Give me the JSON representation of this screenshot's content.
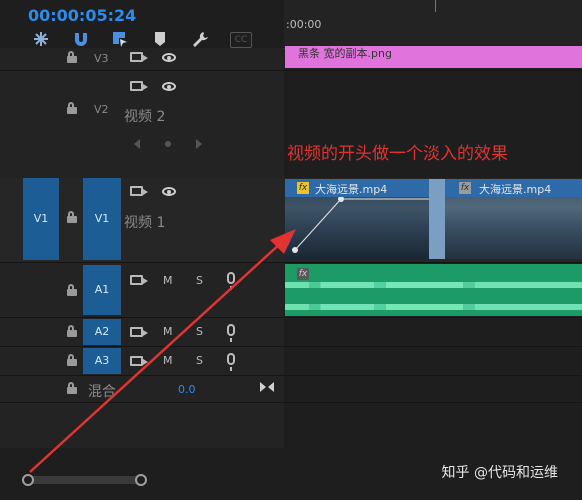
{
  "timecode": "00:00:05:24",
  "ruler": {
    "start_label": ":00:00"
  },
  "toolbar": {
    "tools": [
      {
        "name": "snap-icon"
      },
      {
        "name": "magnet-icon"
      },
      {
        "name": "linked-selection-icon"
      },
      {
        "name": "marker-icon"
      },
      {
        "name": "wrench-icon"
      },
      {
        "name": "captions-icon",
        "label": "CC"
      }
    ]
  },
  "tracks": {
    "v3": {
      "label": "V3"
    },
    "v2": {
      "label": "V2",
      "name": "视频 2"
    },
    "v1": {
      "source": "V1",
      "label": "V1",
      "name": "视频 1"
    },
    "a1": {
      "label": "A1",
      "m": "M",
      "s": "S"
    },
    "a2": {
      "label": "A2",
      "m": "M",
      "s": "S"
    },
    "a3": {
      "label": "A3",
      "m": "M",
      "s": "S"
    },
    "mix": {
      "label": "混合",
      "value": "0.0"
    }
  },
  "clips": {
    "graphic": "黑条 宽的副本.png",
    "video1": {
      "name": "大海远景.mp4",
      "fx": "fx"
    },
    "video2": {
      "name": "大海远景.mp4",
      "fx": "fx"
    },
    "audio_fx": "fx"
  },
  "annotation": "视频的开头做一个淡入的效果",
  "watermark": "知乎 @代码和运维",
  "colors": {
    "accent": "#2d8ceb",
    "track_target": "#1b5d94",
    "graphic_clip": "#e074dc",
    "video_clip_header": "#2f6aa8",
    "audio_clip": "#1d9b67",
    "annotation": "#e23232"
  }
}
